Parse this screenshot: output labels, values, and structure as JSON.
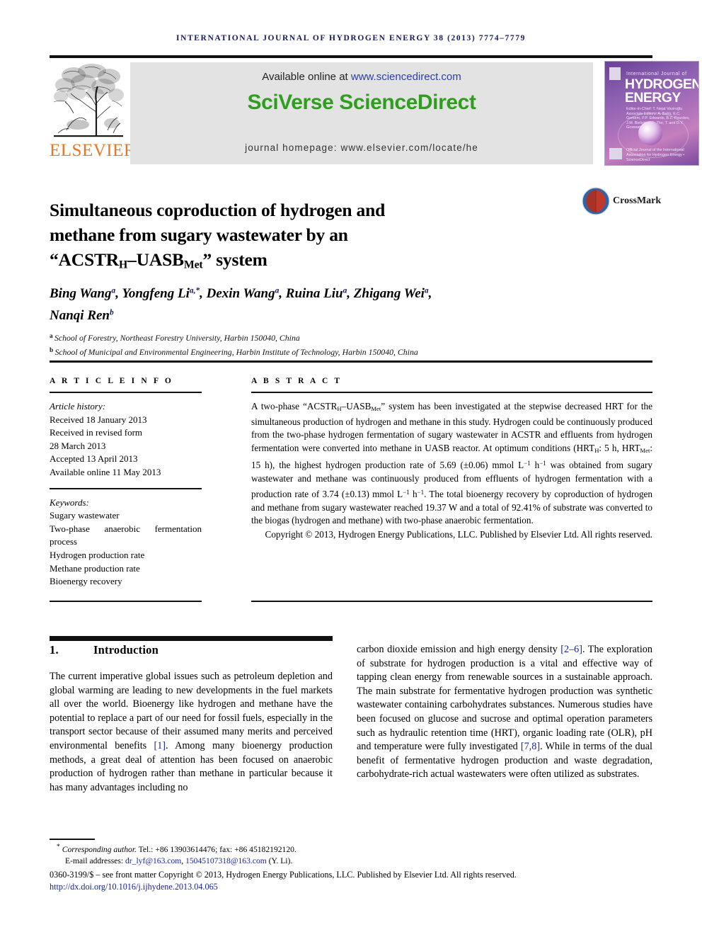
{
  "running_head": "International Journal of Hydrogen Energy 38 (2013) 7774–7779",
  "masthead": {
    "publisher_logo_name": "elsevier-tree-logo",
    "publisher_wordmark": "ELSEVIER",
    "available_online_prefix": "Available online at ",
    "available_online_url": "www.sciencedirect.com",
    "sciverse_wordmark": "SciVerse ScienceDirect",
    "journal_homepage": "journal homepage: www.elsevier.com/locate/he",
    "sciverse_color": "#2f9e1f",
    "link_color": "#2a3fa8",
    "band_color": "#e3e3e3",
    "elsevier_orange": "#e87722",
    "cover": {
      "line_top": "International Journal of",
      "title_line1": "HYDROGEN",
      "title_line2": "ENERGY",
      "editors": "Editor-in-Chief: T. Nejat Veziroğlu  Associate Editors: A. Bahlı, E.C. Gorkem, P.P. Edwards, B.Z. Pourdes, J.M. Bielicki, L.A. Tho, T. and D.Y. Goswami",
      "footer": "Official Journal of the International Association for Hydrogen Energy • ScienceDirect"
    }
  },
  "article": {
    "title_line1": "Simultaneous coproduction of hydrogen and",
    "title_line2": "methane from sugary wastewater by an",
    "title_line3_pre": "“ACSTR",
    "title_line3_sub1": "H",
    "title_line3_mid": "–UASB",
    "title_line3_sub2": "Met",
    "title_line3_post": "” system",
    "crossmark_label": "CrossMark",
    "authors_line1": "Bing Wang a, Yongfeng Li a,*, Dexin Wang a, Ruina Liu a, Zhigang Wei a,",
    "authors_line2": "Nanqi Ren b",
    "affiliation_a": "School of Forestry, Northeast Forestry University, Harbin 150040, China",
    "affiliation_b": "School of Municipal and Environmental Engineering, Harbin Institute of Technology, Harbin 150040, China"
  },
  "article_info": {
    "heading": "A R T I C L E   I N F O",
    "history_label": "Article history:",
    "history": [
      "Received 18 January 2013",
      "Received in revised form",
      "28 March 2013",
      "Accepted 13 April 2013",
      "Available online 11 May 2013"
    ],
    "keywords_label": "Keywords:",
    "keywords": [
      "Sugary wastewater",
      "Two-phase anaerobic fermentation process",
      "Hydrogen production rate",
      "Methane production rate",
      "Bioenergy recovery"
    ]
  },
  "abstract": {
    "heading": "A B S T R A C T",
    "body_1": "A two-phase “ACSTR",
    "body_sub1": "H",
    "body_2": "–UASB",
    "body_sub2": "Met",
    "body_3": "” system has been investigated at the stepwise decreased HRT for the simultaneous production of hydrogen and methane in this study. Hydrogen could be continuously produced from the two-phase hydrogen fermentation of sugary wastewater in ACSTR and effluents from hydrogen fermentation were converted into methane in UASB reactor. At optimum conditions (HRT",
    "body_sub3": "H",
    "body_4": ": 5 h, HRT",
    "body_sub4": "Met",
    "body_5": ": 15 h), the highest hydrogen production rate of 5.69 (±0.06) mmol L",
    "body_sup1": "−1",
    "body_6": " h",
    "body_sup2": "−1",
    "body_7": " was obtained from sugary wastewater and methane was continuously produced from effluents of hydrogen fermentation with a production rate of 3.74 (±0.13) mmol L",
    "body_sup3": "−1",
    "body_8": " h",
    "body_sup4": "−1",
    "body_9": ". The total bioenergy recovery by coproduction of hydrogen and methane from sugary wastewater reached 19.37 W and a total of 92.41% of substrate was converted to the biogas (hydrogen and methane) with two-phase anaerobic fermentation.",
    "copyright": "Copyright © 2013, Hydrogen Energy Publications, LLC. Published by Elsevier Ltd. All rights reserved."
  },
  "introduction": {
    "number": "1.",
    "heading": "Introduction",
    "left_para_a": "The current imperative global issues such as petroleum depletion and global warming are leading to new developments in the fuel markets all over the world. Bioenergy like hydrogen and methane have the potential to replace a part of our need for fossil fuels, especially in the transport sector because of their assumed many merits and perceived environmental benefits ",
    "left_cite_1": "[1]",
    "left_para_b": ". Among many bioenergy production methods, a great deal of attention has been focused on anaerobic production of hydrogen rather than methane in particular because it has many advantages including no",
    "right_para_a": "carbon dioxide emission and high energy density ",
    "right_cite_1": "[2–6]",
    "right_para_b": ". The exploration of substrate for hydrogen production is a vital and effective way of tapping clean energy from renewable sources in a sustainable approach. The main substrate for fermentative hydrogen production was synthetic wastewater containing carbohydrates substances. Numerous studies have been focused on glucose and sucrose and optimal operation parameters such as hydraulic retention time (HRT), organic loading rate (OLR), pH and temperature were fully investigated ",
    "right_cite_2": "[7,8]",
    "right_para_c": ". While in terms of the dual benefit of fermentative hydrogen production and waste degradation, carbohydrate-rich actual wastewaters were often utilized as substrates."
  },
  "footer": {
    "corresponding_marker": "*",
    "corresponding": "Corresponding author. Tel.: +86 13903614476; fax: +86 45182192120.",
    "email_label": "E-mail addresses: ",
    "email_1": "dr_lyf@163.com",
    "email_sep": ", ",
    "email_2": "15045107318@163.com",
    "email_suffix": " (Y. Li).",
    "front_matter": "0360-3199/$ – see front matter Copyright © 2013, Hydrogen Energy Publications, LLC. Published by Elsevier Ltd. All rights reserved.",
    "doi": "http://dx.doi.org/10.1016/j.ijhydene.2013.04.065"
  }
}
